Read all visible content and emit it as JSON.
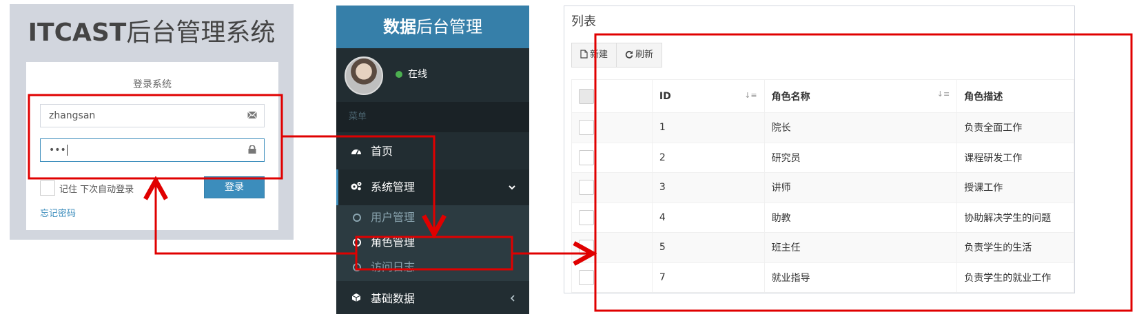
{
  "login": {
    "title_bold": "ITCAST",
    "title_rest": "后台管理系统",
    "box_msg": "登录系统",
    "username_value": "zhangsan",
    "password_value": "•••",
    "remember_label": "记住 下次自动登录",
    "login_button": "登录",
    "forgot_link": "忘记密码",
    "icons": {
      "username": "envelope-icon",
      "password": "lock-icon"
    }
  },
  "sidebar": {
    "logo_bold": "数据",
    "logo_rest": "后台管理",
    "user_status": "在线",
    "menu_header": "菜单",
    "items": [
      {
        "label": "首页",
        "icon": "dashboard-icon"
      },
      {
        "label": "系统管理",
        "icon": "cogs-icon",
        "expanded": true
      },
      {
        "label": "基础数据",
        "icon": "cube-icon"
      }
    ],
    "sub_items": [
      {
        "label": "用户管理"
      },
      {
        "label": "角色管理",
        "active": true
      },
      {
        "label": "访问日志"
      }
    ]
  },
  "list": {
    "title": "列表",
    "toolbar": {
      "new_label": "新建",
      "refresh_label": "刷新"
    },
    "columns": [
      "ID",
      "角色名称",
      "角色描述"
    ],
    "rows": [
      {
        "id": "1",
        "name": "院长",
        "desc": "负责全面工作"
      },
      {
        "id": "2",
        "name": "研究员",
        "desc": "课程研发工作"
      },
      {
        "id": "3",
        "name": "讲师",
        "desc": "授课工作"
      },
      {
        "id": "4",
        "name": "助教",
        "desc": "协助解决学生的问题"
      },
      {
        "id": "5",
        "name": "班主任",
        "desc": "负责学生的生活"
      },
      {
        "id": "7",
        "name": "就业指导",
        "desc": "负责学生的就业工作"
      }
    ]
  },
  "colors": {
    "highlight": "#e00000",
    "accent": "#3c8dbc",
    "sidebar_bg": "#222d32"
  }
}
